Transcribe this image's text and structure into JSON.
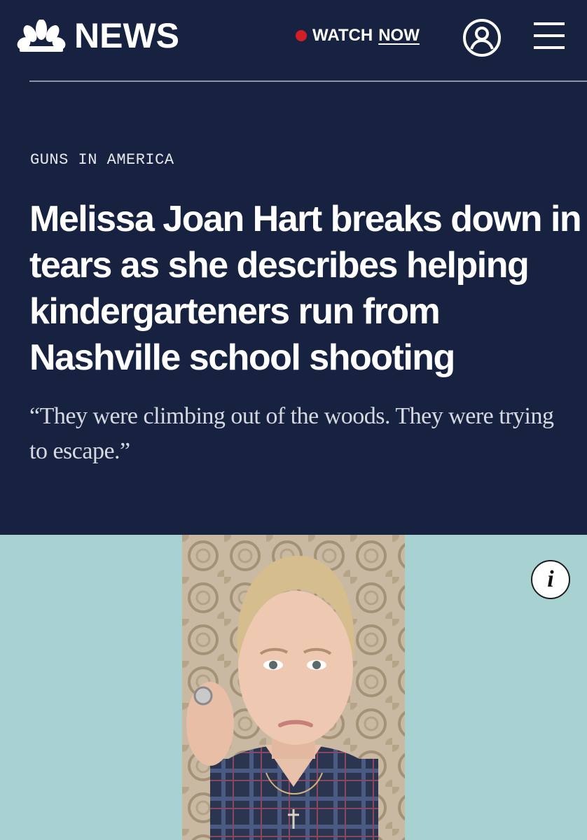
{
  "header": {
    "brand": "NEWS",
    "watch_label": "WATCH",
    "watch_now_label": "NOW",
    "live_dot_color": "#d11f26",
    "account_icon": "user-circle-icon",
    "menu_icon": "hamburger-menu-icon"
  },
  "article": {
    "kicker": "GUNS IN AMERICA",
    "headline": "Melissa Joan Hart breaks down in tears as she describes helping kindergarteners run from Nashville school shooting",
    "dek": "“They were climbing out of the woods. They were trying to escape.”"
  },
  "media": {
    "background_color": "#a8d2d2",
    "info_label": "i"
  },
  "colors": {
    "header_bg": "#172240",
    "text_primary": "#ffffff"
  }
}
